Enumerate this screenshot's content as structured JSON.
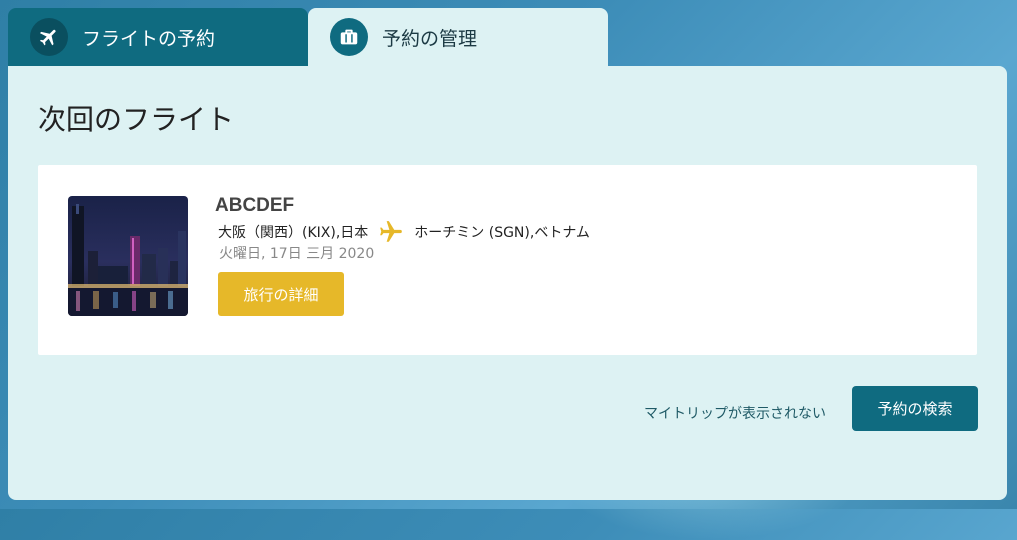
{
  "tabs": {
    "book": {
      "label": "フライトの予約",
      "icon": "airplane-icon"
    },
    "manage": {
      "label": "予約の管理",
      "icon": "briefcase-icon"
    }
  },
  "panel": {
    "title": "次回のフライト"
  },
  "flight": {
    "booking_ref": "ABCDEF",
    "origin": "大阪（関西）(KIX),日本",
    "destination": "ホーチミン (SGN),ベトナム",
    "date": "火曜日, 17日 三月 2020",
    "details_label": "旅行の詳細",
    "thumbnail": "city-night-skyline-image"
  },
  "footer": {
    "missing_trip_link": "マイトリップが表示されない",
    "search_label": "予約の検索"
  },
  "colors": {
    "primary": "#0f6b80",
    "panel_bg": "#ddf2f3",
    "accent_gold": "#e6b829"
  }
}
